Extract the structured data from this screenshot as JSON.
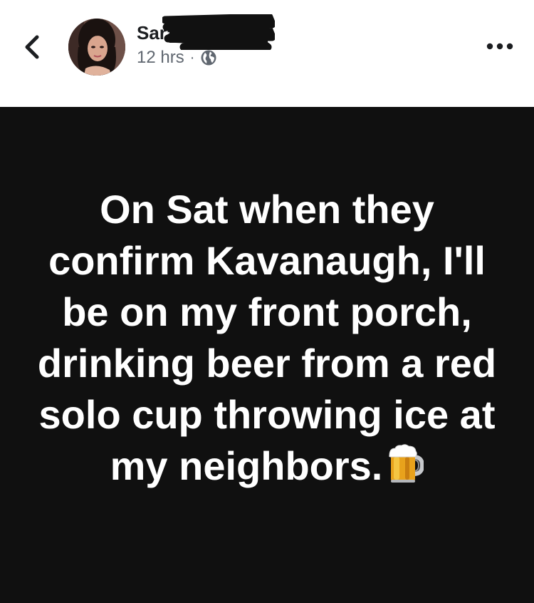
{
  "header": {
    "author_name": "Sarah Stiehl",
    "timestamp": "12 hrs",
    "separator": "·",
    "privacy_icon": "globe-icon",
    "back_icon": "chevron-left-icon",
    "more_icon": "more-horizontal-icon"
  },
  "post": {
    "text": "On Sat when they confirm Kavanaugh, I'll be on my front porch, drinking beer from a red solo cup throwing ice at my neighbors.",
    "emoji_icon": "beer-mug-icon",
    "background_color": "#101010",
    "text_color": "#ffffff"
  }
}
